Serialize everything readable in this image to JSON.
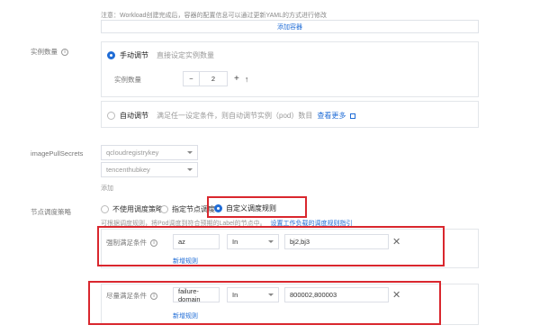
{
  "top_note": "注意：Workload创建完成后，容器的配置信息可以通过更新YAML的方式进行修改",
  "add_container": "添加容器",
  "instances": {
    "label": "实例数量",
    "manual_label": "手动调节",
    "manual_desc": "直接设定实例数量",
    "count_label": "实例数量",
    "minus": "−",
    "count_value": "2",
    "plus": "+",
    "up": "↑",
    "auto_label": "自动调节",
    "auto_desc": "满足任一设定条件，则自动调节实例（pod）数目",
    "auto_link": "查看更多"
  },
  "image_pull": {
    "label": "imagePullSecrets",
    "select1": "qcloudregistrykey",
    "select2": "tencenthubkey",
    "add": "添加"
  },
  "schedule": {
    "label": "节点调度策略",
    "opt1": "不使用调度策略",
    "opt2": "指定节点调度",
    "opt3": "自定义调度规则",
    "desc": "可根据调度规则，将Pod调度到符合预期的Label的节点中。",
    "desc_link": "设置工作负载的调度规则指引"
  },
  "required_rule": {
    "label": "强制满足条件",
    "key": "az",
    "operator": "In",
    "value": "bj2,bj3",
    "add_rule": "新增规则"
  },
  "preferred_rule": {
    "label": "尽量满足条件",
    "key": "failure-domain",
    "operator": "In",
    "value": "800002,800003",
    "add_rule": "新增规则"
  }
}
